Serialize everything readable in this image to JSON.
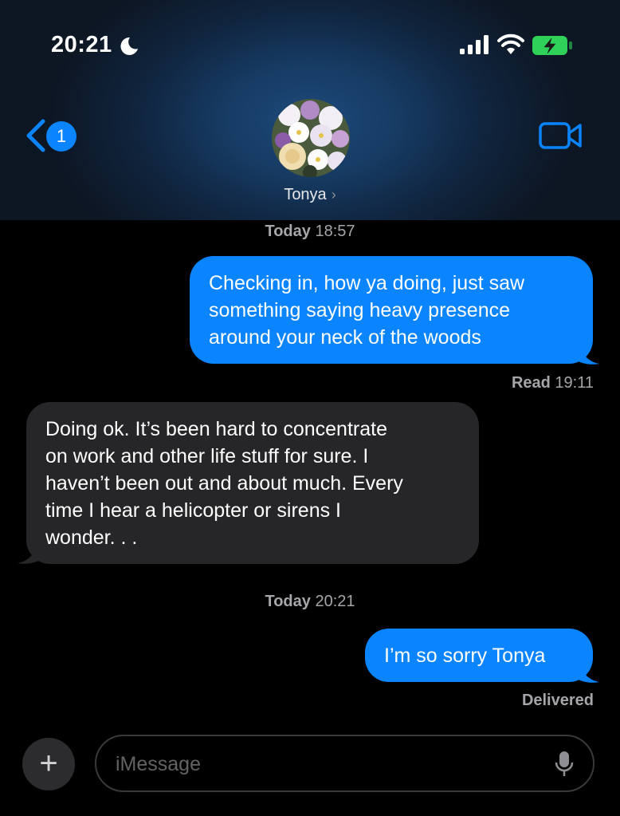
{
  "status_bar": {
    "time": "20:21",
    "icons": [
      "moon-icon",
      "signal-icon",
      "wifi-icon",
      "battery-charging-icon"
    ]
  },
  "header": {
    "back_badge": "1",
    "contact_name": "Tonya",
    "chevron": "›",
    "video_icon": "video-camera-icon"
  },
  "thread": [
    {
      "type": "timestamp",
      "day": "Today",
      "time": "18:57"
    },
    {
      "type": "outgoing",
      "text": "Checking in, how ya doing, just saw something saying heavy presence around your neck of the woods",
      "lines": [
        "Checking in, how ya doing, just saw",
        "something saying heavy presence",
        "around your neck of the woods"
      ]
    },
    {
      "type": "receipt",
      "label": "Read",
      "time": "19:11"
    },
    {
      "type": "incoming",
      "text": "Doing ok. It’s been hard to concentrate on work and other life stuff for sure. I haven’t been out and about much. Every time I hear a helicopter or sirens I wonder. . .",
      "lines": [
        "Doing ok. It’s been hard to concentrate",
        "on work and other life stuff for sure. I",
        "haven’t been out and about much. Every",
        "time I hear a helicopter or sirens I",
        "wonder. . ."
      ]
    },
    {
      "type": "timestamp",
      "day": "Today",
      "time": "20:21"
    },
    {
      "type": "outgoing",
      "text": "I’m so sorry Tonya",
      "lines": [
        "I’m so sorry Tonya"
      ]
    },
    {
      "type": "receipt",
      "label": "Delivered",
      "time": ""
    }
  ],
  "composer": {
    "placeholder": "iMessage",
    "plus_label": "+"
  },
  "colors": {
    "bubble_out": "#0a84ff",
    "bubble_in": "#262628",
    "background": "#000000"
  }
}
